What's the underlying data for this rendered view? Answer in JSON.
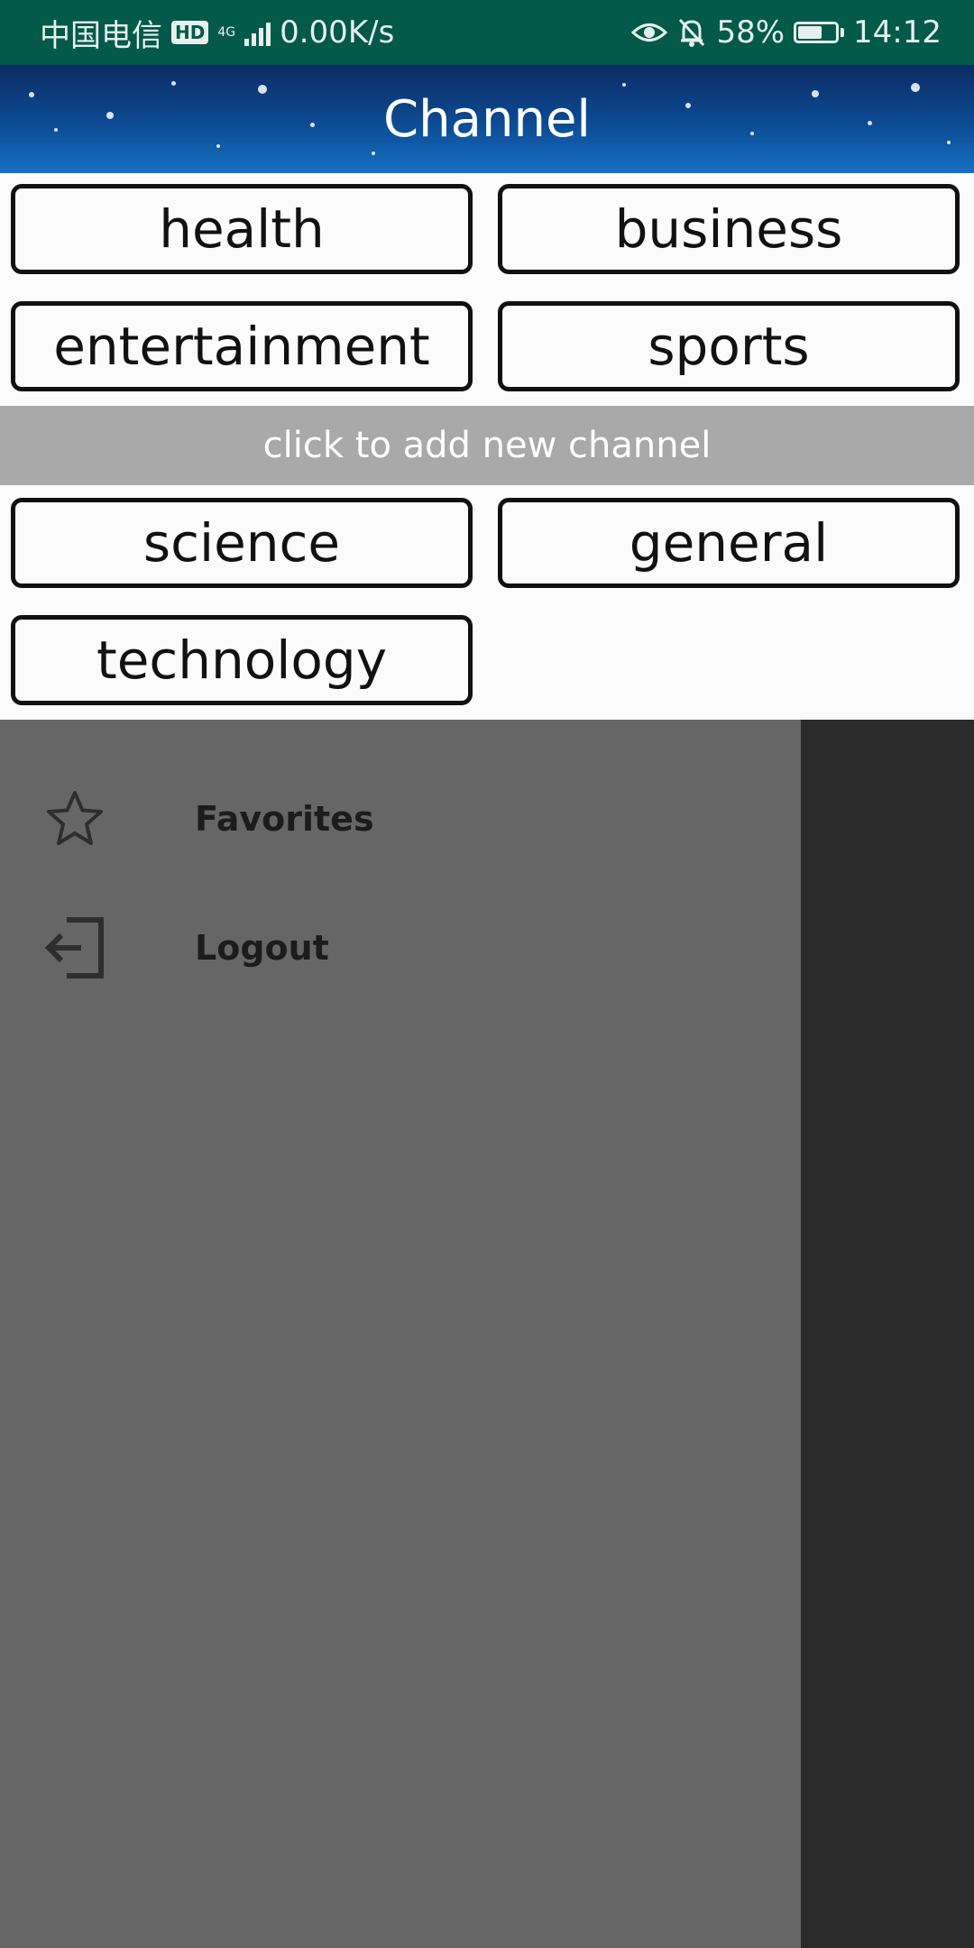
{
  "status_bar": {
    "carrier": "中国电信",
    "hd": "HD",
    "network": "4G",
    "speed": "0.00K/s",
    "battery": "58%",
    "time": "14:12"
  },
  "channel": {
    "title": "Channel",
    "my_channels": [
      "health",
      "business",
      "entertainment",
      "sports"
    ],
    "add_bar_label": "click to add new channel",
    "other_channels": [
      "science",
      "general",
      "technology"
    ]
  },
  "drawer": {
    "items": [
      {
        "label": "Favorites",
        "icon": "star-icon"
      },
      {
        "label": "Logout",
        "icon": "logout-icon"
      }
    ]
  },
  "colors": {
    "status_bar_bg": "#03594a",
    "header_bg": "#0d4b94",
    "add_bar_bg": "#a9a9a9",
    "drawer_bg": "#666666",
    "scrim_bg": "#2b2b2b"
  }
}
